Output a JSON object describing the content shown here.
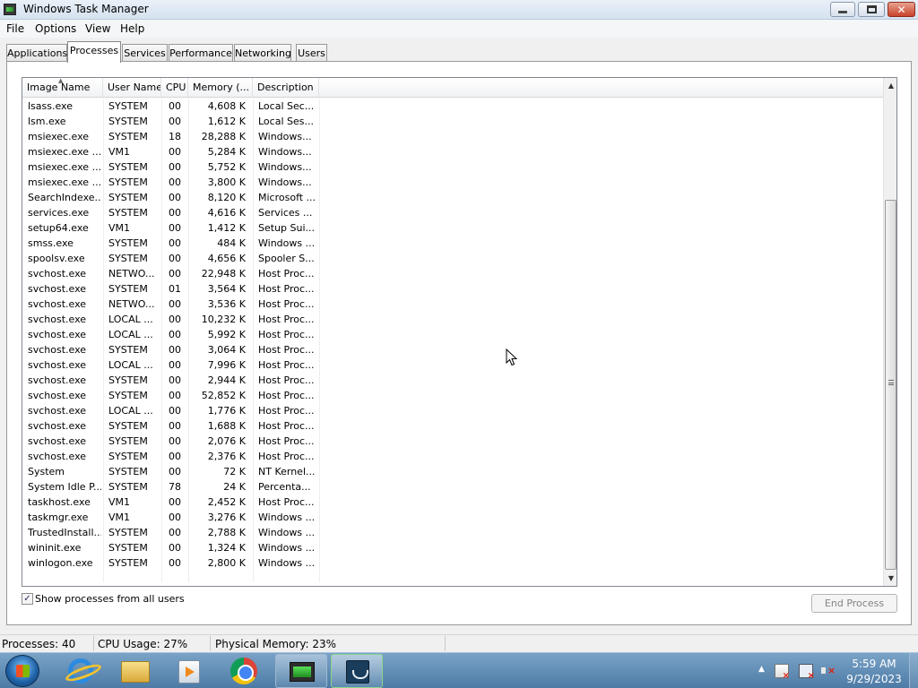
{
  "window": {
    "title": "Windows Task Manager"
  },
  "menu": [
    "File",
    "Options",
    "View",
    "Help"
  ],
  "tabs": [
    "Applications",
    "Processes",
    "Services",
    "Performance",
    "Networking",
    "Users"
  ],
  "active_tab": "Processes",
  "columns": [
    "Image Name",
    "User Name",
    "CPU",
    "Memory (...",
    "Description"
  ],
  "sorted_column": "Image Name",
  "processes": [
    [
      "lsass.exe",
      "SYSTEM",
      "00",
      "4,608 K",
      "Local Sec..."
    ],
    [
      "lsm.exe",
      "SYSTEM",
      "00",
      "1,612 K",
      "Local Ses..."
    ],
    [
      "msiexec.exe",
      "SYSTEM",
      "18",
      "28,288 K",
      "Windows..."
    ],
    [
      "msiexec.exe ...",
      "VM1",
      "00",
      "5,284 K",
      "Windows..."
    ],
    [
      "msiexec.exe ...",
      "SYSTEM",
      "00",
      "5,752 K",
      "Windows..."
    ],
    [
      "msiexec.exe ...",
      "SYSTEM",
      "00",
      "3,800 K",
      "Windows..."
    ],
    [
      "SearchIndexe...",
      "SYSTEM",
      "00",
      "8,120 K",
      "Microsoft ..."
    ],
    [
      "services.exe",
      "SYSTEM",
      "00",
      "4,616 K",
      "Services ..."
    ],
    [
      "setup64.exe",
      "VM1",
      "00",
      "1,412 K",
      "Setup Sui..."
    ],
    [
      "smss.exe",
      "SYSTEM",
      "00",
      "484 K",
      "Windows ..."
    ],
    [
      "spoolsv.exe",
      "SYSTEM",
      "00",
      "4,656 K",
      "Spooler S..."
    ],
    [
      "svchost.exe",
      "NETWO...",
      "00",
      "22,948 K",
      "Host Proc..."
    ],
    [
      "svchost.exe",
      "SYSTEM",
      "01",
      "3,564 K",
      "Host Proc..."
    ],
    [
      "svchost.exe",
      "NETWO...",
      "00",
      "3,536 K",
      "Host Proc..."
    ],
    [
      "svchost.exe",
      "LOCAL ...",
      "00",
      "10,232 K",
      "Host Proc..."
    ],
    [
      "svchost.exe",
      "LOCAL ...",
      "00",
      "5,992 K",
      "Host Proc..."
    ],
    [
      "svchost.exe",
      "SYSTEM",
      "00",
      "3,064 K",
      "Host Proc..."
    ],
    [
      "svchost.exe",
      "LOCAL ...",
      "00",
      "7,996 K",
      "Host Proc..."
    ],
    [
      "svchost.exe",
      "SYSTEM",
      "00",
      "2,944 K",
      "Host Proc..."
    ],
    [
      "svchost.exe",
      "SYSTEM",
      "00",
      "52,852 K",
      "Host Proc..."
    ],
    [
      "svchost.exe",
      "LOCAL ...",
      "00",
      "1,776 K",
      "Host Proc..."
    ],
    [
      "svchost.exe",
      "SYSTEM",
      "00",
      "1,688 K",
      "Host Proc..."
    ],
    [
      "svchost.exe",
      "SYSTEM",
      "00",
      "2,076 K",
      "Host Proc..."
    ],
    [
      "svchost.exe",
      "SYSTEM",
      "00",
      "2,376 K",
      "Host Proc..."
    ],
    [
      "System",
      "SYSTEM",
      "00",
      "72 K",
      "NT Kernel..."
    ],
    [
      "System Idle P...",
      "SYSTEM",
      "78",
      "24 K",
      "Percenta..."
    ],
    [
      "taskhost.exe",
      "VM1",
      "00",
      "2,452 K",
      "Host Proc..."
    ],
    [
      "taskmgr.exe",
      "VM1",
      "00",
      "3,276 K",
      "Windows ..."
    ],
    [
      "TrustedInstall...",
      "SYSTEM",
      "00",
      "2,788 K",
      "Windows ..."
    ],
    [
      "wininit.exe",
      "SYSTEM",
      "00",
      "1,324 K",
      "Windows ..."
    ],
    [
      "winlogon.exe",
      "SYSTEM",
      "00",
      "2,800 K",
      "Windows ..."
    ]
  ],
  "show_all_users": {
    "label": "Show processes from all users",
    "checked": true
  },
  "end_process_label": "End Process",
  "status": {
    "processes": "Processes: 40",
    "cpu": "CPU Usage: 27%",
    "memory": "Physical Memory: 23%"
  },
  "taskbar": {
    "pinned": [
      "start-orb",
      "internet-explorer-icon",
      "windows-explorer-icon",
      "media-player-icon",
      "chrome-icon",
      "task-manager-icon",
      "installer-icon"
    ],
    "clock_time": "5:59 AM",
    "clock_date": "9/29/2023"
  }
}
